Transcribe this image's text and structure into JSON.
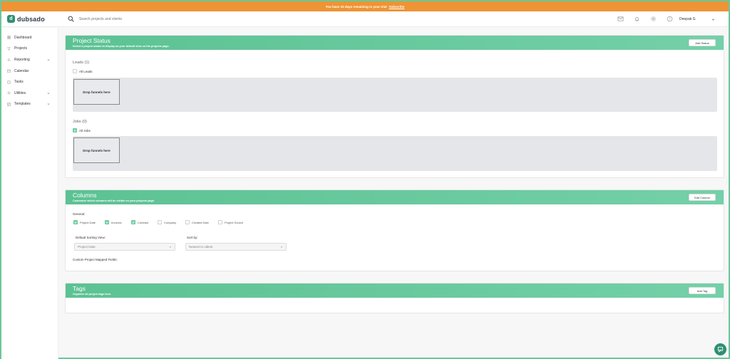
{
  "trial_bar": {
    "message": "You have 10 days remaining in your trial",
    "link": "Subscribe"
  },
  "brand": {
    "logo_letter": "d",
    "name": "dubsado"
  },
  "search": {
    "placeholder": "Search projects and clients"
  },
  "user": {
    "name": "Deepak G"
  },
  "sidebar": {
    "items": [
      {
        "label": "Dashboard",
        "icon": "grid-icon",
        "has_submenu": false
      },
      {
        "label": "Projects",
        "icon": "filter-icon",
        "has_submenu": false
      },
      {
        "label": "Reporting",
        "icon": "chart-icon",
        "has_submenu": true
      },
      {
        "label": "Calendar",
        "icon": "calendar-icon",
        "has_submenu": false
      },
      {
        "label": "Tasks",
        "icon": "tasks-icon",
        "has_submenu": false
      },
      {
        "label": "Utilities",
        "icon": "sliders-icon",
        "has_submenu": true
      },
      {
        "label": "Templates",
        "icon": "templates-icon",
        "has_submenu": true
      }
    ]
  },
  "project_status": {
    "title": "Project Status",
    "subtitle": "Select a project status to display as your default view on the projects page.",
    "button": "Add Status",
    "leads": {
      "heading": "Leads (1)",
      "all_label": "All Leads",
      "checked": false,
      "drop_text": "Drop funnels here"
    },
    "jobs": {
      "heading": "Jobs (0)",
      "all_label": "All Jobs",
      "checked": true,
      "drop_text": "Drop funnels here"
    }
  },
  "columns": {
    "title": "Columns",
    "subtitle": "Customize which columns will be visible on your projects page.",
    "button": "Edit Column",
    "general_label": "General:",
    "options": [
      {
        "label": "Project Date",
        "checked": true
      },
      {
        "label": "Invoices",
        "checked": true
      },
      {
        "label": "Contract",
        "checked": true
      },
      {
        "label": "Company",
        "checked": false
      },
      {
        "label": "Created Date",
        "checked": false
      },
      {
        "label": "Project Source",
        "checked": false
      }
    ],
    "default_sorting_label": "Default Sorting View:",
    "default_sorting_value": "Project Date",
    "sort_by_label": "Sort by:",
    "sort_by_value": "Newest to oldest",
    "custom_fields_label": "Custom Project Mapped Fields:"
  },
  "tags": {
    "title": "Tags",
    "subtitle": "Organize all project tags here.",
    "button": "Add Tag"
  },
  "colors": {
    "accent": "#5cc293",
    "trial": "#ee9434",
    "brand": "#2f8f73"
  }
}
